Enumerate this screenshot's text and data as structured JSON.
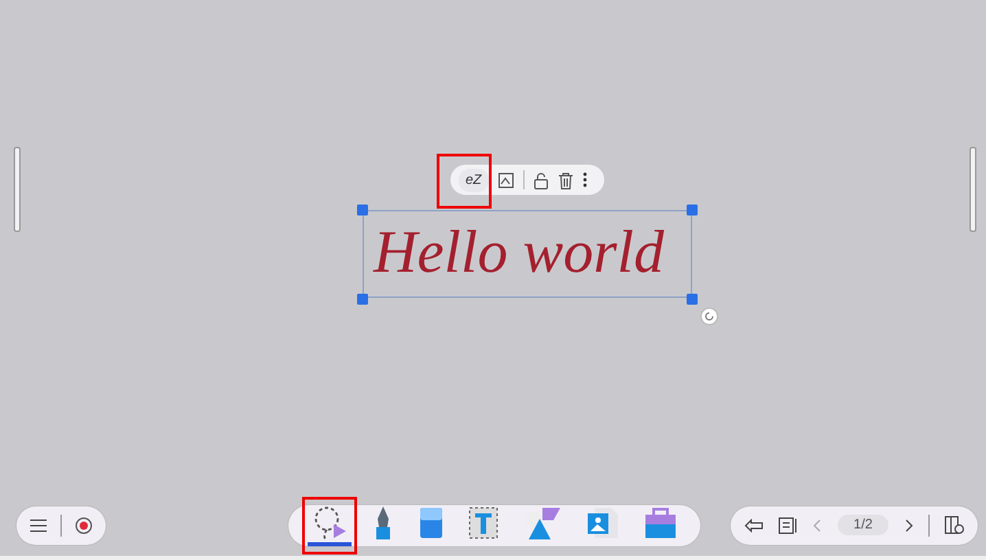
{
  "canvas": {
    "ink_text": "Hello world",
    "selected": true
  },
  "context_toolbar": {
    "convert_label": "eZ"
  },
  "tools": [
    {
      "kind": "lasso",
      "selected": true
    },
    {
      "kind": "pen",
      "selected": false
    },
    {
      "kind": "eraser",
      "selected": false
    },
    {
      "kind": "text",
      "selected": false
    },
    {
      "kind": "shapes",
      "selected": false
    },
    {
      "kind": "image",
      "selected": false
    },
    {
      "kind": "toolbox",
      "selected": false
    }
  ],
  "pager": {
    "page": "1/2"
  }
}
